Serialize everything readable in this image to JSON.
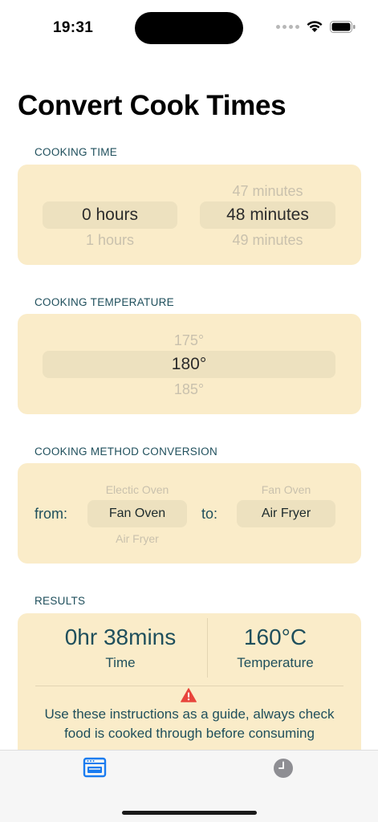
{
  "status_bar": {
    "time": "19:31"
  },
  "title": "Convert Cook Times",
  "cooking_time": {
    "label": "COOKING TIME",
    "hours": {
      "above": "",
      "selected": "0 hours",
      "below": "1 hours"
    },
    "minutes": {
      "above": "47 minutes",
      "selected": "48 minutes",
      "below": "49 minutes"
    }
  },
  "temperature": {
    "label": "COOKING TEMPERATURE",
    "above": "175°",
    "selected": "180°",
    "below": "185°"
  },
  "method": {
    "label": "COOKING METHOD CONVERSION",
    "from_label": "from:",
    "to_label": "to:",
    "from": {
      "above": "Electic Oven",
      "selected": "Fan Oven",
      "below": "Air Fryer"
    },
    "to": {
      "above": "Fan Oven",
      "selected": "Air Fryer",
      "below": ""
    }
  },
  "results": {
    "label": "RESULTS",
    "time_value": "0hr 38mins",
    "time_caption": "Time",
    "temp_value": "160°C",
    "temp_caption": "Temperature",
    "note": "Use these instructions as a guide, always check food is cooked through before consuming"
  },
  "tabs": [
    {
      "name": "oven-icon",
      "active": true
    },
    {
      "name": "clock-icon",
      "active": false
    }
  ],
  "colors": {
    "card": "#faecc9",
    "accent": "#1f4f5c",
    "tab_active": "#1a7cf0",
    "warning": "#e8453c"
  }
}
